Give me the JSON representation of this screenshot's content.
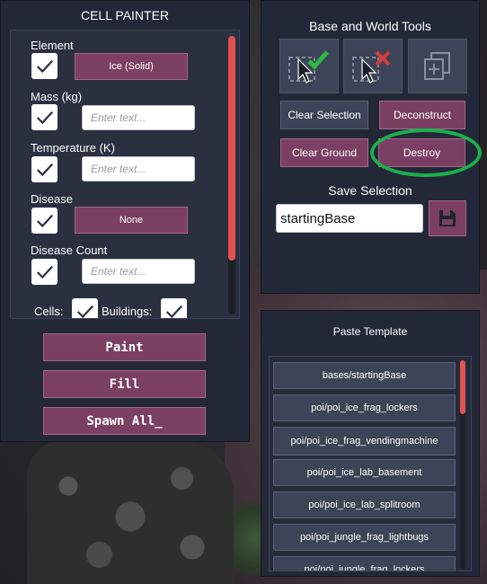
{
  "cell_painter": {
    "title": "CELL PAINTER",
    "element": {
      "label": "Element",
      "value": "Ice (Solid)",
      "checked": true
    },
    "mass": {
      "label": "Mass (kg)",
      "placeholder": "Enter text...",
      "checked": true
    },
    "temperature": {
      "label": "Temperature (K)",
      "placeholder": "Enter text...",
      "checked": true
    },
    "disease": {
      "label": "Disease",
      "value": "None",
      "checked": true
    },
    "disease_count": {
      "label": "Disease Count",
      "placeholder": "Enter text...",
      "checked": true
    },
    "cells_label": "Cells:",
    "buildings_label": "Buildings:",
    "paint_button": "Paint",
    "fill_button": "Fill",
    "spawn_all_button": "Spawn All_"
  },
  "tools": {
    "title": "Base and World Tools",
    "icons": [
      "select-area-icon",
      "deselect-area-icon",
      "copy-icon"
    ],
    "clear_selection": "Clear Selection",
    "deconstruct": "Deconstruct",
    "clear_ground": "Clear Ground",
    "destroy": "Destroy",
    "save_selection_label": "Save Selection",
    "save_input_value": "startingBase",
    "save_icon": "floppy-disk-icon"
  },
  "paste_template": {
    "title": "Paste Template",
    "items": [
      "bases/startingBase",
      "poi/poi_ice_frag_lockers",
      "poi/poi_ice_frag_vendingmachine",
      "poi/poi_ice_lab_basement",
      "poi/poi_ice_lab_splitroom",
      "poi/poi_jungle_frag_lightbugs",
      "poi/poi_jungle_frag_lockers"
    ]
  },
  "colors": {
    "panel": "#232838",
    "accent_pink": "#7b3f63",
    "scroll_red": "#e05252",
    "highlight_green": "#1bb04a"
  }
}
